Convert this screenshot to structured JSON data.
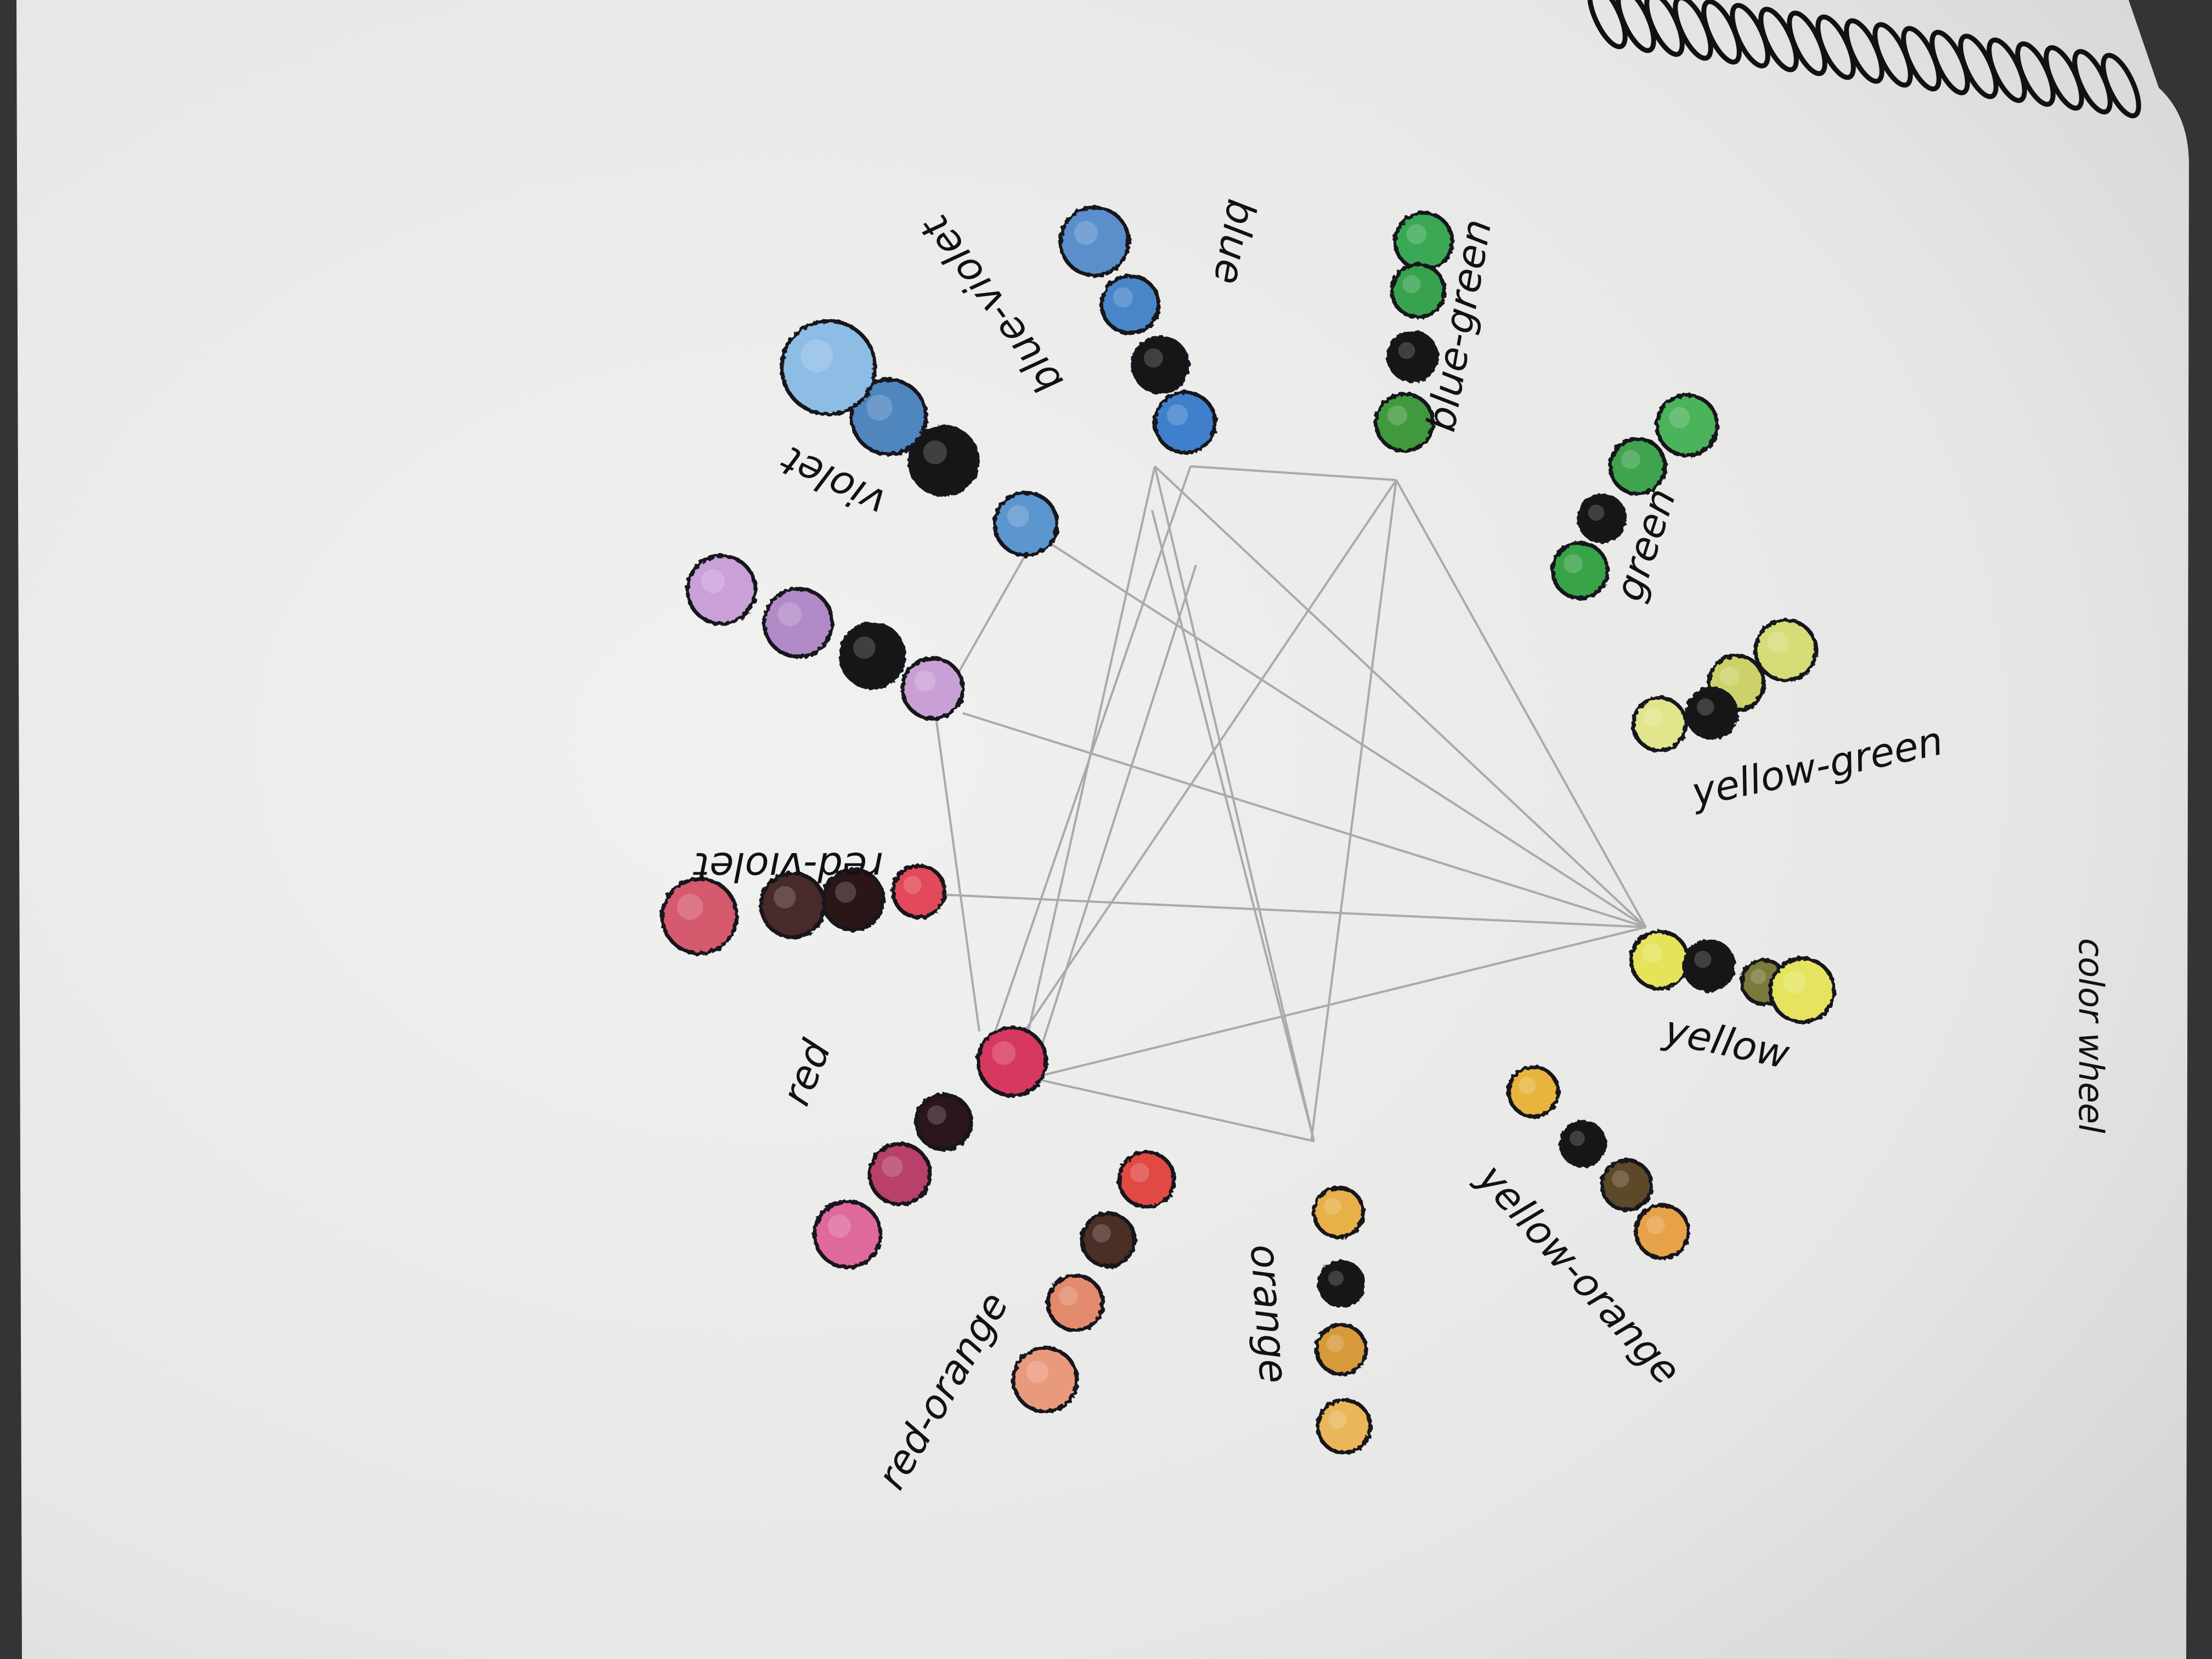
{
  "title": "color wheel",
  "swatch_outline": "#14121a",
  "pencil_line": "#9a9aa0",
  "groups": [
    {
      "id": "blue",
      "label": "blue",
      "colors": [
        "#5a8fcc",
        "#4a86c8",
        "#121216",
        "#3f7fcb"
      ]
    },
    {
      "id": "blue-green",
      "label": "blue-green",
      "colors": [
        "#3aa857",
        "#38a24f",
        "#141414",
        "#3f9a3e"
      ]
    },
    {
      "id": "green",
      "label": "green",
      "colors": [
        "#4cb35a",
        "#3fa34e",
        "#151515",
        "#39a347"
      ]
    },
    {
      "id": "yellow-green",
      "label": "yellow-green",
      "colors": [
        "#d6dc78",
        "#cdd16a",
        "#161616",
        "#e1e68c"
      ]
    },
    {
      "id": "yellow",
      "label": "yellow",
      "colors": [
        "#e4e35a",
        "#151515",
        "#7b7a3a",
        "#e6e45e"
      ]
    },
    {
      "id": "yellow-orange",
      "label": "yellow-orange",
      "colors": [
        "#e7b53c",
        "#141414",
        "#5c4a2a",
        "#e7a24a"
      ]
    },
    {
      "id": "orange",
      "label": "orange",
      "colors": [
        "#e7b04a",
        "#141414",
        "#d79a3a",
        "#eab65a"
      ]
    },
    {
      "id": "red-orange",
      "label": "red-orange",
      "colors": [
        "#e14a44",
        "#4b2f26",
        "#e48a6c",
        "#e99a7c"
      ]
    },
    {
      "id": "red",
      "label": "red",
      "colors": [
        "#d7385e",
        "#2a161a",
        "#b8416b",
        "#de6a9b"
      ]
    },
    {
      "id": "red-violet",
      "label": "red-violet",
      "colors": [
        "#e2485a",
        "#2a1418",
        "#4a2a2a",
        "#d55a6e"
      ]
    },
    {
      "id": "violet",
      "label": "violet",
      "colors": [
        "#c9a0d6",
        "#151215",
        "#b28ac8",
        "#caa0d9"
      ]
    },
    {
      "id": "blue-violet",
      "label": "blue-violet",
      "colors": [
        "#5c96cf",
        "#171717",
        "#4f86be",
        "#8dbce4"
      ]
    }
  ]
}
